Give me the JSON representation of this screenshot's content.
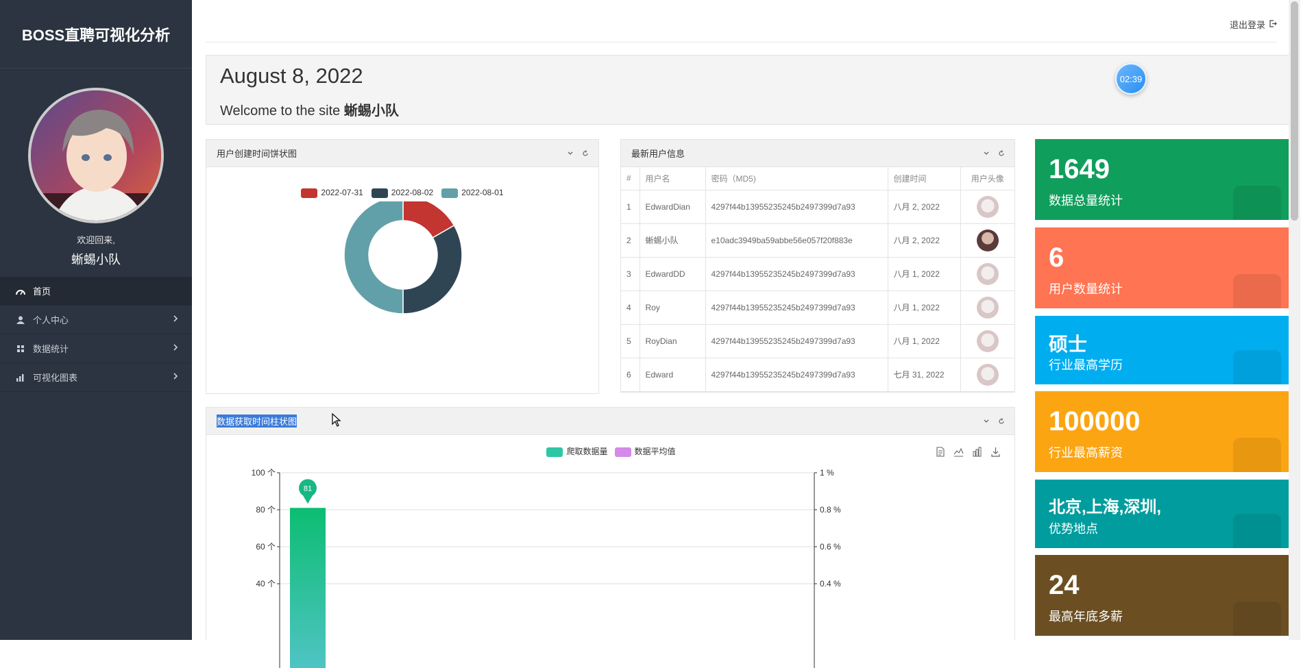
{
  "app": {
    "title": "BOSS直聘可视化分析"
  },
  "sidebar": {
    "welcome": "欢迎回来,",
    "username": "蜥蜴小队",
    "items": [
      {
        "label": "首页",
        "icon": "dashboard-icon",
        "active": true
      },
      {
        "label": "个人中心",
        "icon": "user-icon"
      },
      {
        "label": "数据统计",
        "icon": "grid-icon"
      },
      {
        "label": "可视化图表",
        "icon": "bar-chart-icon"
      }
    ]
  },
  "topbar": {
    "logout": "退出登录"
  },
  "hero": {
    "date": "August 8, 2022",
    "welcome_prefix": "Welcome to the site",
    "welcome_name": "蜥蜴小队",
    "clock": "02:39"
  },
  "pie_panel": {
    "title": "用户创建时间饼状图",
    "legend": [
      "2022-07-31",
      "2022-08-02",
      "2022-08-01"
    ],
    "colors": [
      "#c23531",
      "#2f4554",
      "#61a0a8"
    ]
  },
  "users_panel": {
    "title": "最新用户信息",
    "columns": [
      "#",
      "用户名",
      "密码（MD5)",
      "创建时间",
      "用户头像"
    ],
    "rows": [
      [
        "1",
        "EdwardDian",
        "4297f44b13955235245b2497399d7a93",
        "八月 2, 2022"
      ],
      [
        "2",
        "蜥蜴小队",
        "e10adc3949ba59abbe56e057f20f883e",
        "八月 2, 2022"
      ],
      [
        "3",
        "EdwardDD",
        "4297f44b13955235245b2497399d7a93",
        "八月 1, 2022"
      ],
      [
        "4",
        "Roy",
        "4297f44b13955235245b2497399d7a93",
        "八月 1, 2022"
      ],
      [
        "5",
        "RoyDian",
        "4297f44b13955235245b2497399d7a93",
        "八月 1, 2022"
      ],
      [
        "6",
        "Edward",
        "4297f44b13955235245b2497399d7a93",
        "七月 31, 2022"
      ]
    ]
  },
  "bar_panel": {
    "title": "数据获取时间柱状图",
    "legend": [
      "爬取数据量",
      "数据平均值"
    ],
    "left_axis_name": "爬取数据量",
    "right_axis_name": "数据平均值",
    "left_ticks": [
      "100 个",
      "80 个",
      "60 个",
      "40 个"
    ],
    "right_ticks": [
      "1 %",
      "0.8 %",
      "0.6 %",
      "0.4 %"
    ],
    "marker_label": "81"
  },
  "chart_data": [
    {
      "type": "pie",
      "categories": [
        "2022-07-31",
        "2022-08-02",
        "2022-08-01"
      ],
      "values": [
        1,
        2,
        3
      ],
      "legend": "top"
    },
    {
      "type": "bar",
      "series": [
        {
          "name": "爬取数据量",
          "values": [
            81
          ]
        },
        {
          "name": "数据平均值",
          "values": []
        }
      ],
      "ylim": [
        0,
        100
      ],
      "y2lim": [
        0,
        1
      ],
      "ylabel": "爬取数据量",
      "y2label": "数据平均值",
      "grid": true,
      "legend": "top"
    }
  ],
  "stats": [
    {
      "value": "1649",
      "label": "数据总量统计",
      "color": "#109e5c"
    },
    {
      "value": "6",
      "label": "用户数量统计",
      "color": "#ff7453"
    },
    {
      "value": "硕士",
      "label": "行业最高学历",
      "color": "#00aef0"
    },
    {
      "value": "100000",
      "label": "行业最高薪资",
      "color": "#fca512"
    },
    {
      "value": "北京,上海,深圳,",
      "label": "优势地点",
      "color": "#019d9e"
    },
    {
      "value": "24",
      "label": "最高年底多薪",
      "color": "#6b4f23"
    }
  ]
}
